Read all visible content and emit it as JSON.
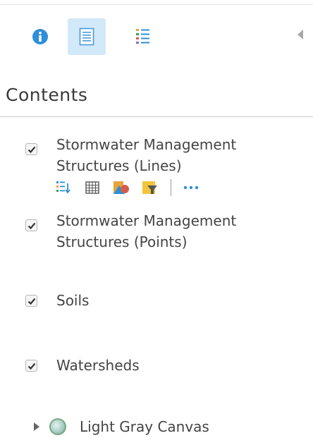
{
  "toolbar": {
    "buttons": [
      {
        "name": "details",
        "icon": "info-icon",
        "active": false
      },
      {
        "name": "contents",
        "icon": "content-list-icon",
        "active": true
      },
      {
        "name": "legend",
        "icon": "legend-icon",
        "active": false
      }
    ],
    "collapse_icon": "collapse-left-icon",
    "accent_color": "#2e8fd8",
    "active_bg_color": "#d2e9f9"
  },
  "panel": {
    "title": "Contents"
  },
  "layers": [
    {
      "title_lines": [
        "Stormwater Management",
        "Structures (Lines)"
      ],
      "checked": true,
      "show_tools": true
    },
    {
      "title_lines": [
        "Stormwater Management",
        "Structures (Points)"
      ],
      "checked": true,
      "show_tools": false
    },
    {
      "title_lines": [
        "Soils"
      ],
      "checked": true,
      "show_tools": false
    },
    {
      "title_lines": [
        "Watersheds"
      ],
      "checked": true,
      "show_tools": false
    }
  ],
  "layer_tools": [
    "show-legend-icon",
    "show-table-icon",
    "change-style-icon",
    "filter-icon",
    "more-options-icon"
  ],
  "basemap": {
    "title": "Light Gray Canvas",
    "expanded": false,
    "icon": "basemap-globe-icon"
  }
}
